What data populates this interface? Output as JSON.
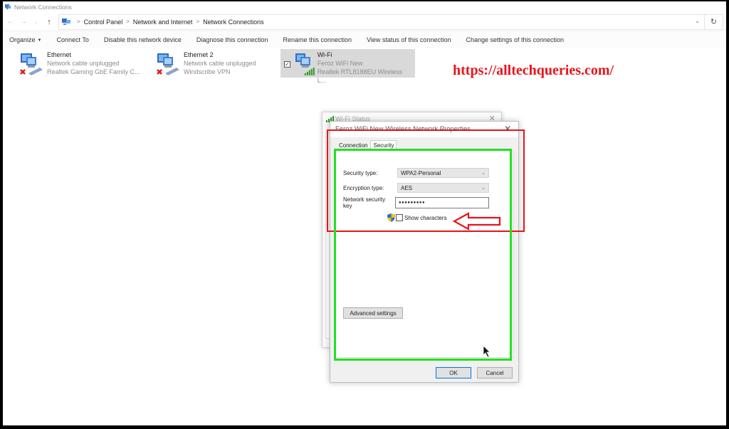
{
  "window": {
    "title": "Network Connections"
  },
  "navigation": {
    "back_icon": "arrow-left-icon",
    "forward_icon": "arrow-right-icon",
    "recent_icon": "chevron-down-icon",
    "up_icon": "arrow-up-icon",
    "breadcrumb": [
      "Control Panel",
      "Network and Internet",
      "Network Connections"
    ],
    "separator": ">",
    "dropdown_glyph": "⌄",
    "refresh_glyph": "↻"
  },
  "commandbar": {
    "items": [
      {
        "label": "Organize",
        "has_caret": true
      },
      {
        "label": "Connect To"
      },
      {
        "label": "Disable this network device"
      },
      {
        "label": "Diagnose this connection"
      },
      {
        "label": "Rename this connection"
      },
      {
        "label": "View status of this connection"
      },
      {
        "label": "Change settings of this connection"
      }
    ],
    "caret": "▼"
  },
  "connections": [
    {
      "name": "Ethernet",
      "status": "Network cable unplugged",
      "adapter": "Realtek Gaming GbE Family C...",
      "state": "disconnected"
    },
    {
      "name": "Ethernet 2",
      "status": "Network cable unplugged",
      "adapter": "Windscribe VPN",
      "state": "disconnected"
    },
    {
      "name": "Wi-Fi",
      "status": "Feroz WiFi New",
      "adapter": "Realtek RTL8188EU Wireless L...",
      "state": "connected",
      "selected": true,
      "checked": "✓"
    }
  ],
  "watermark": "https://alltechqueries.com/",
  "status_dialog": {
    "title": "Wi-Fi Status",
    "close": "✕"
  },
  "properties_dialog": {
    "title": "Feroz WiFi New Wireless Network Properties",
    "close": "✕",
    "tabs": [
      {
        "label": "Connection",
        "active": false
      },
      {
        "label": "Security",
        "active": true
      }
    ],
    "security_type": {
      "label": "Security type:",
      "value": "WPA2-Personal"
    },
    "encryption_type": {
      "label": "Encryption type:",
      "value": "AES"
    },
    "network_key": {
      "label": "Network security key",
      "value": "●●●●●●●●●"
    },
    "show_characters": {
      "label": "Show characters",
      "checked": false
    },
    "advanced_button": "Advanced settings",
    "ok_button": "OK",
    "cancel_button": "Cancel",
    "chevron": "⌄"
  },
  "annotations": {
    "highlight_colors": {
      "red": "#e8141b",
      "green": "#22e022"
    }
  }
}
